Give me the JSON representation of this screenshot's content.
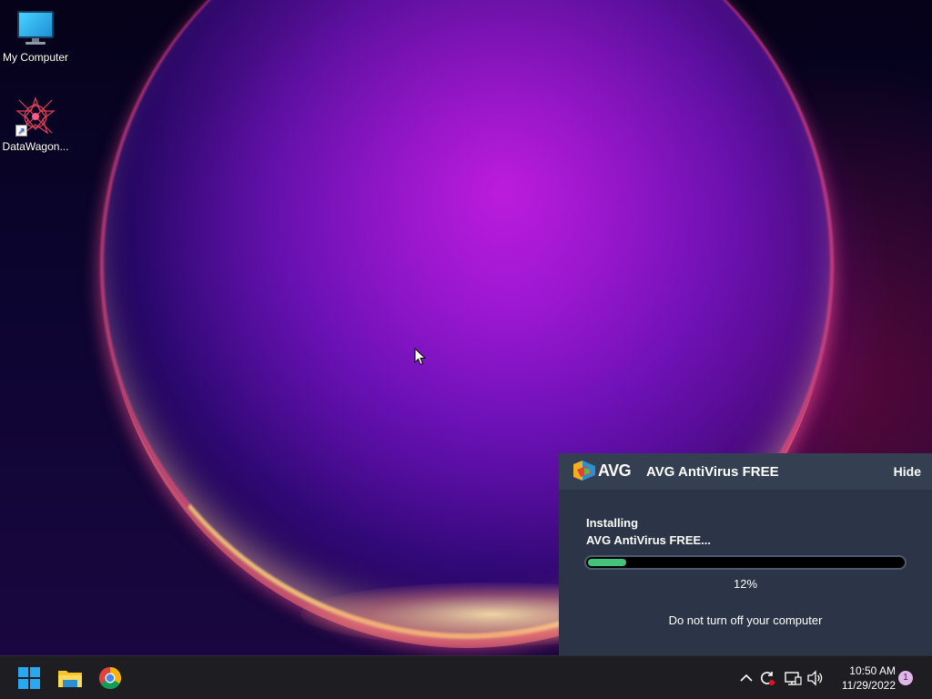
{
  "desktop": {
    "icons": [
      {
        "label": "My Computer",
        "icon": "monitor-icon"
      },
      {
        "label": "DataWagon...",
        "icon": "datawagon-icon"
      }
    ]
  },
  "avg": {
    "logo_text": "AVG",
    "title": "AVG AntiVirus FREE",
    "hide_label": "Hide",
    "status_line1": "Installing",
    "status_line2": "AVG AntiVirus FREE...",
    "progress_fraction": 0.12,
    "progress_text": "12%",
    "warning": "Do not turn off your computer",
    "colors": {
      "panel_bg": "#2b3547",
      "header_bg": "#343f52",
      "progress": "#46c37b"
    }
  },
  "taskbar": {
    "pinned": [
      {
        "name": "start",
        "icon": "windows-logo-icon"
      },
      {
        "name": "file-explorer",
        "icon": "folder-icon"
      },
      {
        "name": "chrome",
        "icon": "chrome-icon"
      }
    ],
    "tray_icons": [
      "chevron-up-icon",
      "sync-icon",
      "network-icon",
      "volume-icon"
    ],
    "clock": {
      "time": "10:50 AM",
      "date": "11/29/2022"
    },
    "notification_count": "1"
  }
}
